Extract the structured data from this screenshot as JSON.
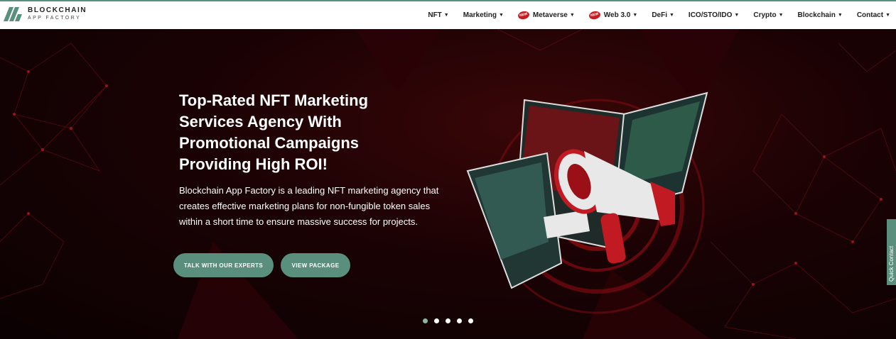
{
  "logo": {
    "line1": "BLOCKCHAIN",
    "line2": "APP FACTORY"
  },
  "nav": [
    {
      "label": "NFT",
      "badge": false
    },
    {
      "label": "Marketing",
      "badge": false
    },
    {
      "label": "Metaverse",
      "badge": true
    },
    {
      "label": "Web 3.0",
      "badge": true
    },
    {
      "label": "DeFi",
      "badge": false
    },
    {
      "label": "ICO/STO/IDO",
      "badge": false
    },
    {
      "label": "Crypto",
      "badge": false
    },
    {
      "label": "Blockchain",
      "badge": false
    },
    {
      "label": "Contact",
      "badge": false
    }
  ],
  "nav_badge_text": "NEW",
  "hero": {
    "title": "Top-Rated NFT Marketing Services Agency With Promotional Campaigns Providing High ROI!",
    "description": "Blockchain App Factory is a leading NFT marketing agency that creates effective marketing plans for non-fungible token sales within a short time to ensure massive success for projects.",
    "btn_experts": "TALK WITH OUR EXPERTS",
    "btn_package": "VIEW PACKAGE"
  },
  "carousel": {
    "slides": 5,
    "active": 0
  },
  "quick_contact": "Quick Contact",
  "colors": {
    "accent": "#5a8f7d",
    "hero_dark": "#1a0204",
    "badge": "#c51b23"
  },
  "icons": [
    "logo-mark-icon",
    "caret-down-icon",
    "megaphone-illustration"
  ]
}
